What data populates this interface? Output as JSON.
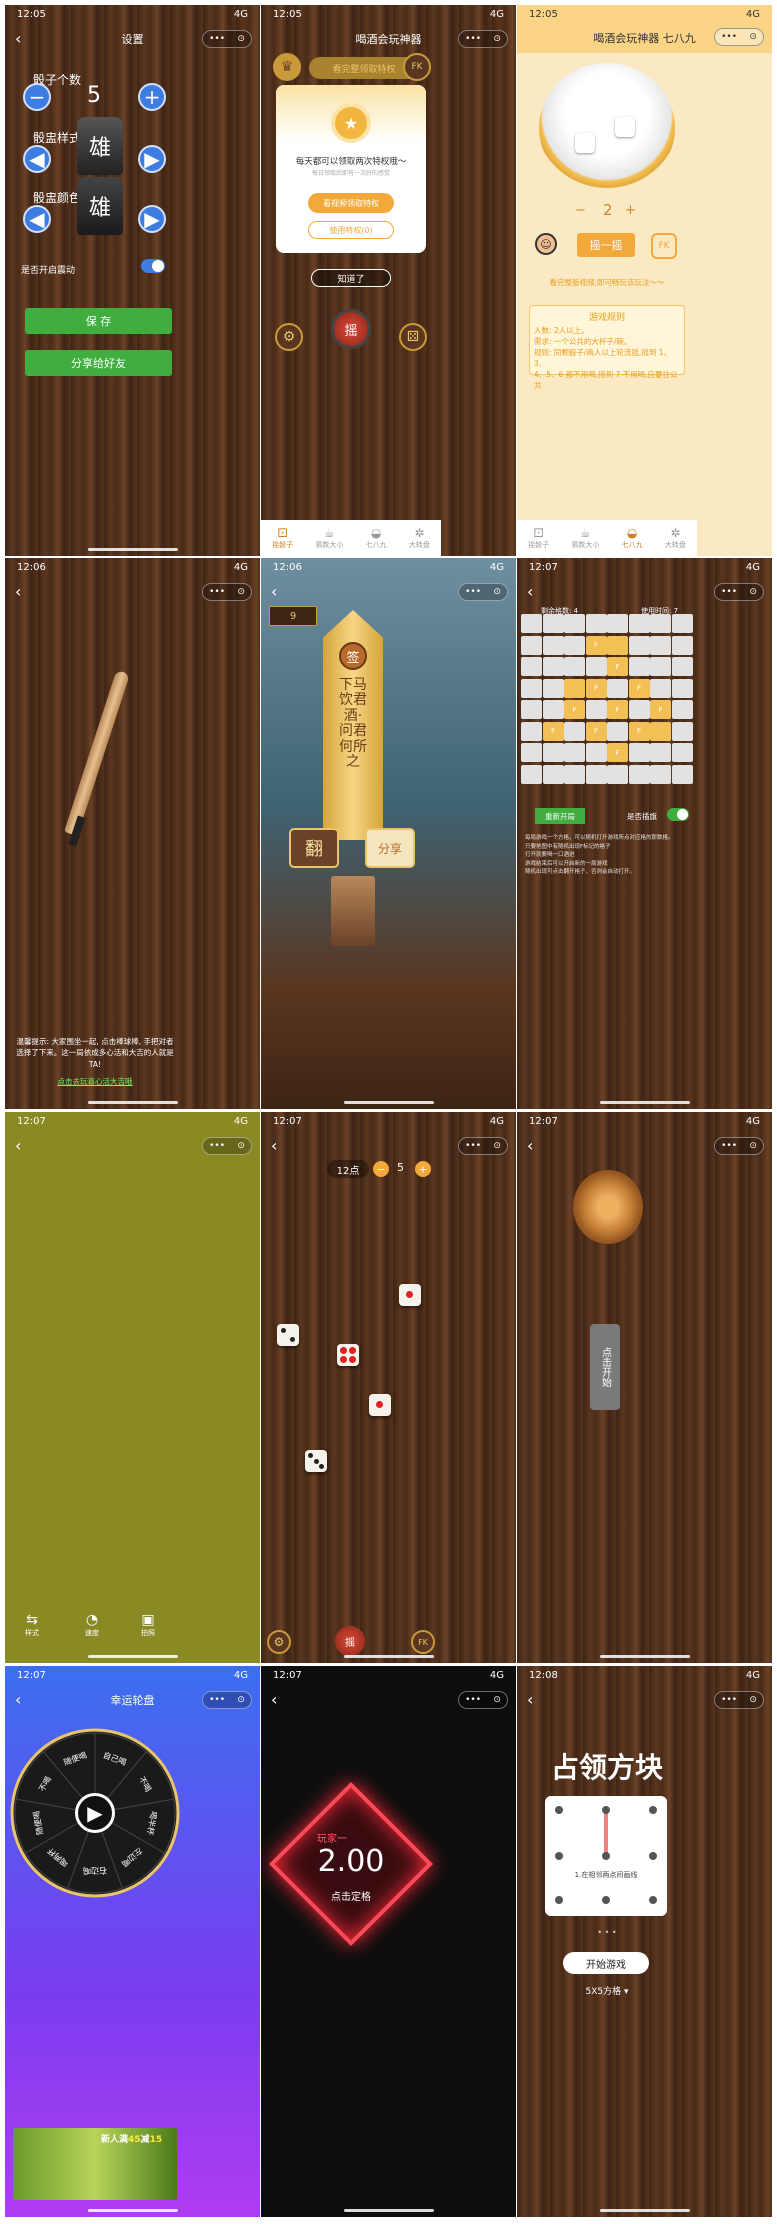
{
  "common": {
    "nav_dots": "•••",
    "target": "⊙",
    "back": "‹",
    "signal": "4G"
  },
  "p1": {
    "time": "12:05",
    "title": "设置",
    "count_label": "骰子个数",
    "count_value": "5",
    "style_label": "骰盅样式",
    "cup_char": "雄",
    "color_label": "骰盅颜色",
    "vibrate_label": "是否开启震动",
    "save": "保 存",
    "share": "分享给好友"
  },
  "p2": {
    "time": "12:05",
    "title": "喝酒会玩神器",
    "banner": "看完整领取特权",
    "modal_title": "每天都可以领取两次特权哦～",
    "modal_sub": "每日领取后即有一次好的感觉",
    "btn_watch": "看视频领取特权",
    "btn_use": "使用特权(0)",
    "know": "知道了",
    "shake": "摇",
    "fk": "FK",
    "tabs": [
      "摇骰子",
      "猜数大小",
      "七八九",
      "大转盘"
    ]
  },
  "p3": {
    "time": "12:05",
    "title": "喝酒会玩神器 七八九",
    "minus": "−",
    "num": "2",
    "plus": "+",
    "shake": "摇一摇",
    "fk": "FK",
    "hint": "看完整版视频,即可畅玩该玩法～～",
    "rules_title": "游戏规则",
    "rules_lines": [
      "人数: 2人以上。",
      "需求: 一个公共的大杯子/碗。",
      "规则: 同颗骰子/两人以上轮流摇,摇到 1、3、",
      "4、5、6 都不用喝,摇到 7 不用喝,应要往公共"
    ],
    "tabs": [
      "摇骰子",
      "猜数大小",
      "七八九",
      "大转盘"
    ]
  },
  "p4": {
    "time": "12:06",
    "tip": "温馨提示: 大家围坐一起, 点击棒球棒, 手把对者选择了下来。这一局依成多心活和大吉的人就是TA!",
    "link": "点击去玩喜心活大吉哦"
  },
  "p5": {
    "time": "12:06",
    "badge": "9",
    "sign": "签",
    "verse": "下马饮君酒·问君何所之",
    "flip": "翻",
    "share": "分享"
  },
  "p6": {
    "time": "12:07",
    "left_label": "剩余格数: 4",
    "right_label": "使用时间: 7",
    "flag": "F",
    "start": "重新开局",
    "flag_label": "是否插旗",
    "rules": [
      "每局游戏一个方格，可以随机打开游戏所点对应格的那数格。",
      "只要地图中有随机出现F标记的格子",
      "打开就要喝一口酒进",
      "游戏结束后可以开启新的一局游戏",
      "随机出现可点击翻开格子，否则会自动打开。"
    ]
  },
  "p7": {
    "time": "12:07",
    "tools": [
      "样式",
      "速度",
      "拍照"
    ]
  },
  "p8": {
    "time": "12:07",
    "points": "12点",
    "minus": "−",
    "count": "5",
    "plus": "+",
    "fk": "FK",
    "shake": "摇"
  },
  "p9": {
    "time": "12:07",
    "open": "点击开始"
  },
  "p10": {
    "time": "12:07",
    "title": "幸运轮盘",
    "segments": [
      "自己喝",
      "不喝",
      "喝半杯",
      "左边喝",
      "右边喝",
      "喝两杯",
      "随便喝",
      "不喝",
      "随便喝"
    ],
    "ad": [
      "新人满",
      "45",
      "减",
      "15"
    ]
  },
  "p11": {
    "time": "12:07",
    "player": "玩家一",
    "value": "2.00",
    "tap": "点击定格"
  },
  "p12": {
    "time": "12:08",
    "title": "占领方块",
    "step": "1.在相邻两点间画线",
    "start": "开始游戏",
    "mode": "5X5方格 ▾"
  }
}
